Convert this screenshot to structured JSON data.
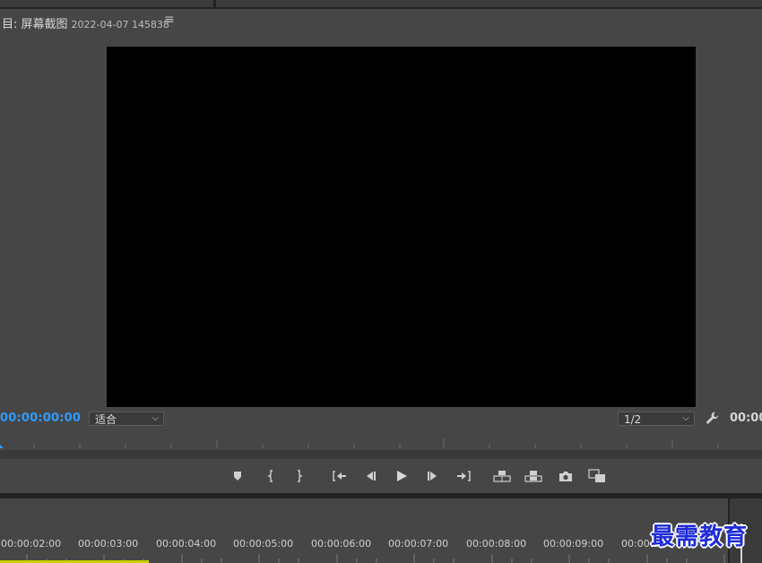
{
  "panel": {
    "title": "目: 屏幕截图",
    "subtitle": "2022-04-07 145838",
    "menu_icon": "hamburger-icon"
  },
  "monitor": {
    "playhead_timecode": "00:00:00:00",
    "duration_timecode": "00:00",
    "zoom_select": {
      "value": "适合"
    },
    "resolution_select": {
      "value": "1/2"
    },
    "settings_icon": "wrench-icon"
  },
  "transport": {
    "buttons": [
      {
        "name": "add-marker",
        "icon": "marker-icon"
      },
      {
        "name": "mark-in",
        "icon": "mark-in-icon"
      },
      {
        "name": "mark-out",
        "icon": "mark-out-icon"
      },
      {
        "name": "go-to-in",
        "icon": "go-to-in-icon"
      },
      {
        "name": "step-back",
        "icon": "step-back-icon"
      },
      {
        "name": "play",
        "icon": "play-icon"
      },
      {
        "name": "step-forward",
        "icon": "step-forward-icon"
      },
      {
        "name": "go-to-out",
        "icon": "go-to-out-icon"
      },
      {
        "name": "insert",
        "icon": "insert-icon"
      },
      {
        "name": "overwrite",
        "icon": "overwrite-icon"
      },
      {
        "name": "export-frame",
        "icon": "camera-icon"
      },
      {
        "name": "comparison-view",
        "icon": "comparison-view-icon"
      }
    ]
  },
  "timeline": {
    "ruler_labels": [
      "00:00:02:00",
      "00:00:03:00",
      "00:00:04:00",
      "00:00:05:00",
      "00:00:06:00",
      "00:00:07:00",
      "00:00:08:00",
      "00:00:09:00",
      "00:00:1"
    ]
  },
  "watermark": {
    "text": "最需教育"
  },
  "colors": {
    "panel_bg": "#464646",
    "video_bg": "#000000",
    "timecode_accent": "#2f9bff",
    "work_area_bar": "#c9d300",
    "watermark": "#1e2bd8"
  }
}
